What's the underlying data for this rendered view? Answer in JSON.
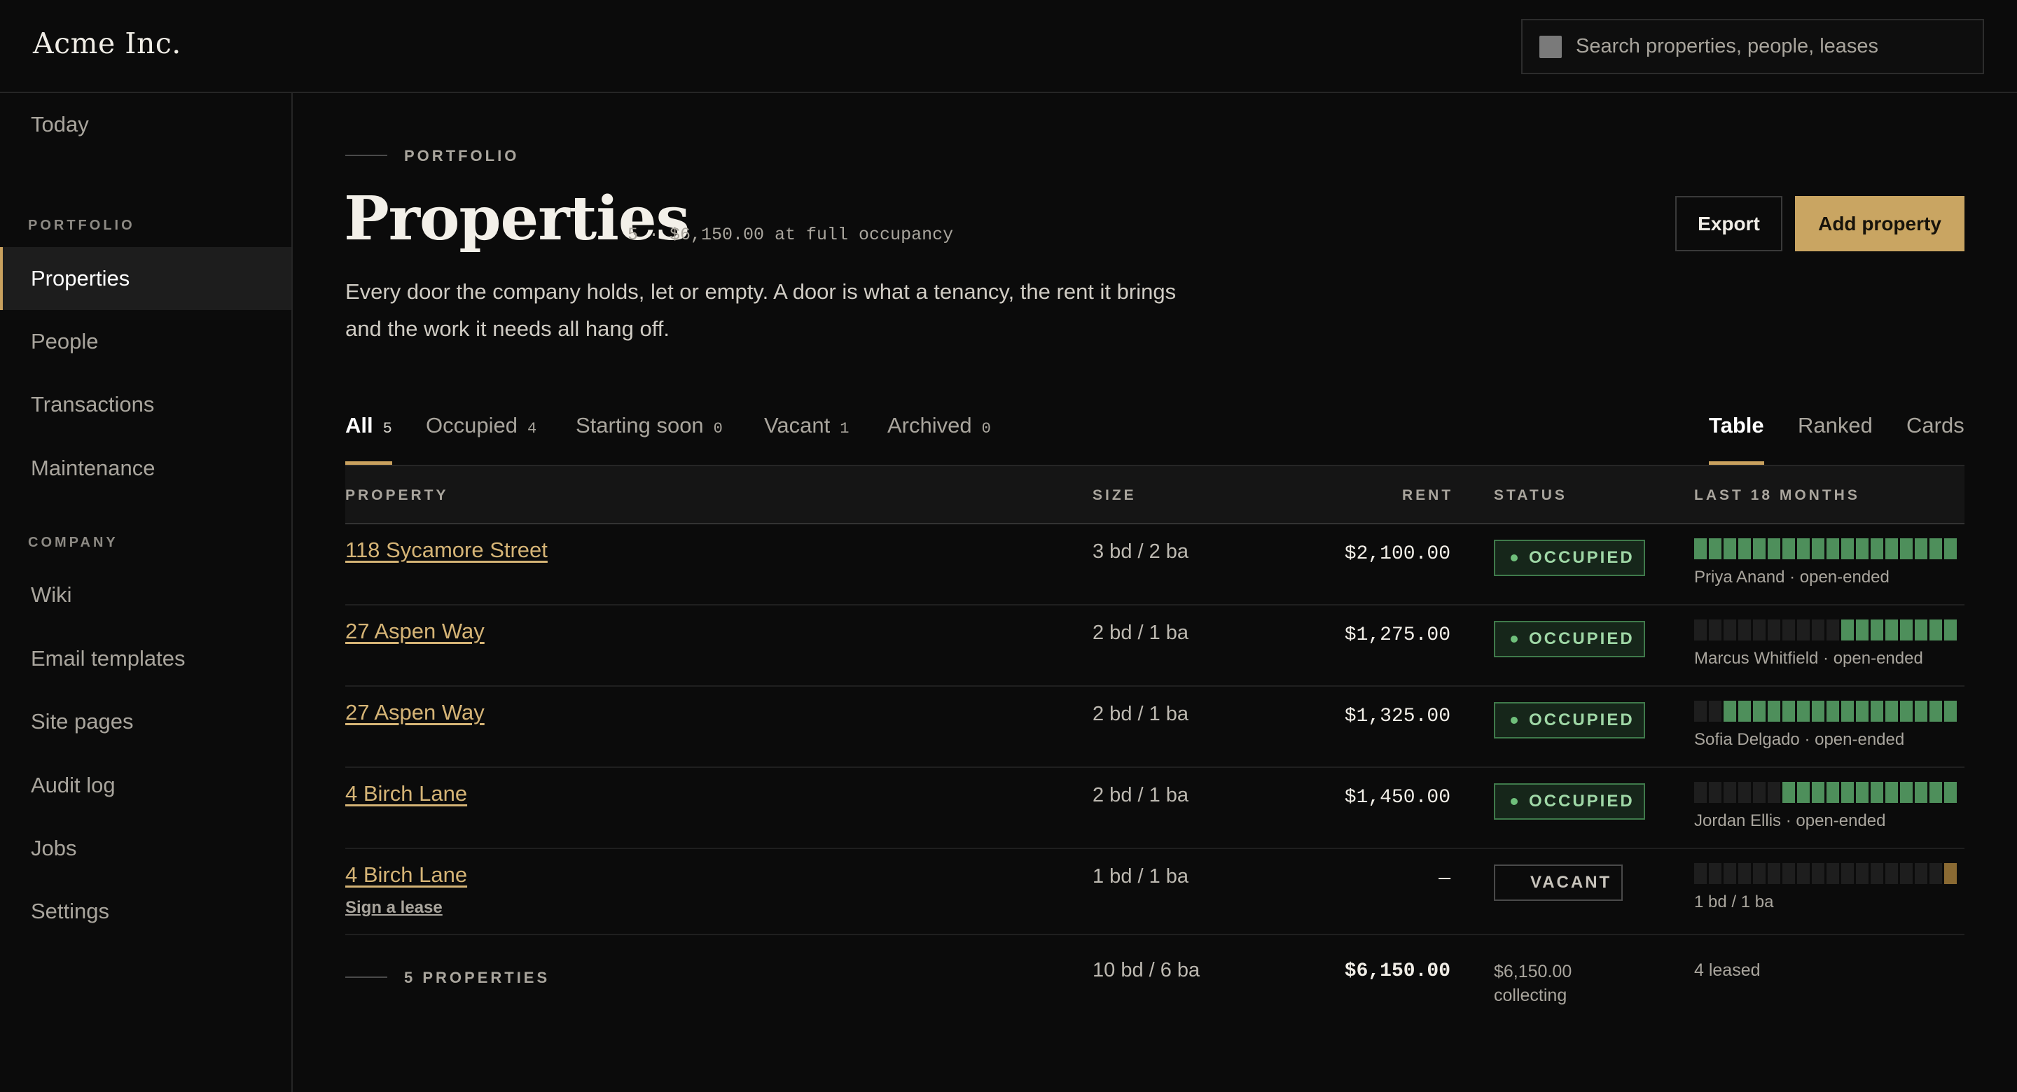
{
  "app": {
    "brand": "Acme Inc."
  },
  "search": {
    "placeholder": "Search properties, people, leases",
    "icon": "search-icon"
  },
  "sidebar": {
    "items_top": [
      {
        "label": "Today"
      }
    ],
    "portfolio_section": "PORTFOLIO",
    "portfolio_items": [
      {
        "label": "Properties",
        "active": true
      },
      {
        "label": "People"
      },
      {
        "label": "Transactions"
      },
      {
        "label": "Maintenance"
      }
    ],
    "company_section": "COMPANY",
    "company_items": [
      {
        "label": "Wiki"
      },
      {
        "label": "Email templates"
      },
      {
        "label": "Site pages"
      },
      {
        "label": "Audit log"
      },
      {
        "label": "Jobs"
      },
      {
        "label": "Settings"
      }
    ]
  },
  "header": {
    "eyebrow": "PORTFOLIO",
    "title": "Properties",
    "meta": "5 · $6,150.00 at full occupancy",
    "description": "Every door the company holds, let or empty. A door is what a tenancy, the rent it brings and the work it needs all hang off.",
    "export_label": "Export",
    "add_label": "Add property"
  },
  "tabs": [
    {
      "label": "All",
      "count": "5",
      "active": true
    },
    {
      "label": "Occupied",
      "count": "4"
    },
    {
      "label": "Starting soon",
      "count": "0"
    },
    {
      "label": "Vacant",
      "count": "1"
    },
    {
      "label": "Archived",
      "count": "0"
    }
  ],
  "views": [
    {
      "label": "Table",
      "active": true
    },
    {
      "label": "Ranked"
    },
    {
      "label": "Cards"
    }
  ],
  "table": {
    "columns": {
      "property": "PROPERTY",
      "size": "SIZE",
      "rent": "RENT",
      "status": "STATUS",
      "history": "LAST 18 MONTHS"
    },
    "rows": [
      {
        "property": "118 Sycamore Street",
        "size": "3 bd / 2 ba",
        "rent": "$2,100.00",
        "status": "OCCUPIED",
        "occupied_months": 18,
        "tenant": "Priya Anand · open-ended"
      },
      {
        "property": "27 Aspen Way",
        "size": "2 bd / 1 ba",
        "rent": "$1,275.00",
        "status": "OCCUPIED",
        "occupied_months": 8,
        "tenant": "Marcus Whitfield · open-ended"
      },
      {
        "property": "27 Aspen Way",
        "size": "2 bd / 1 ba",
        "rent": "$1,325.00",
        "status": "OCCUPIED",
        "occupied_months": 16,
        "tenant": "Sofia Delgado · open-ended"
      },
      {
        "property": "4 Birch Lane",
        "size": "2 bd / 1 ba",
        "rent": "$1,450.00",
        "status": "OCCUPIED",
        "occupied_months": 12,
        "tenant": "Jordan Ellis · open-ended"
      },
      {
        "property": "4 Birch Lane",
        "sublink": "Sign a lease",
        "size": "1 bd / 1 ba",
        "rent": "—",
        "status": "VACANT",
        "occupied_months": 0,
        "tenant": "1 bd / 1 ba"
      }
    ],
    "footer": {
      "label": "5 PROPERTIES",
      "size": "10 bd / 6 ba",
      "rent": "$6,150.00",
      "collecting_amount": "$6,150.00",
      "collecting_label": "collecting",
      "leased": "4 leased"
    }
  },
  "colors": {
    "accent": "#c9a562",
    "occupied": "#4e8f5b",
    "vacant_warn": "#8a6a33"
  }
}
